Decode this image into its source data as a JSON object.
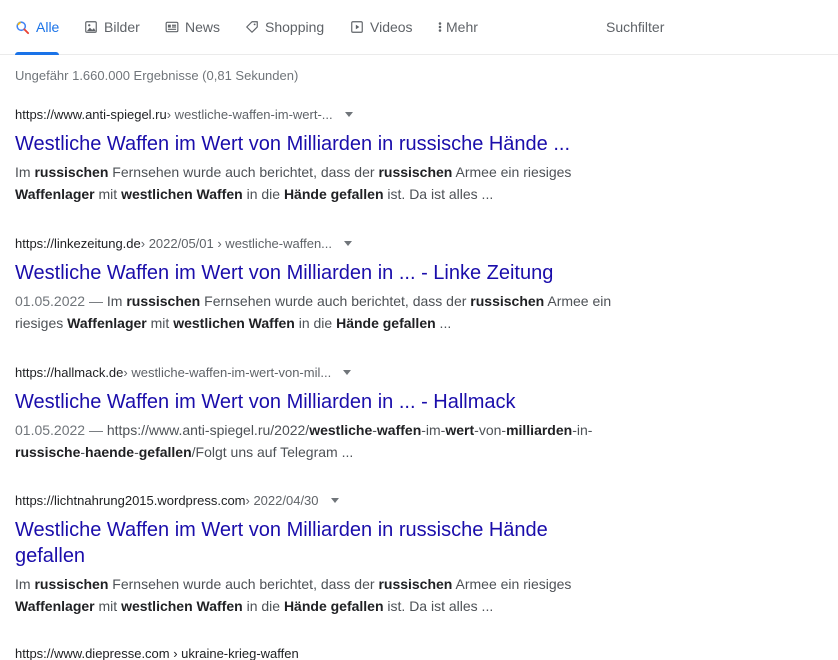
{
  "tabs": [
    {
      "label": "Alle",
      "icon": "search-icon"
    },
    {
      "label": "Bilder",
      "icon": "image-icon"
    },
    {
      "label": "News",
      "icon": "news-icon"
    },
    {
      "label": "Shopping",
      "icon": "tag-icon"
    },
    {
      "label": "Videos",
      "icon": "play-icon"
    },
    {
      "label": "Mehr",
      "icon": "more-vertical-icon"
    }
  ],
  "filter_label": "Suchfilter",
  "stats": "Ungefähr 1.660.000 Ergebnisse (0,81 Sekunden)",
  "results": [
    {
      "domain": "https://www.anti-spiegel.ru",
      "path": " › westliche-waffen-im-wert-...",
      "title": "Westliche Waffen im Wert von Milliarden in russische Hände ...",
      "snippet_html": "Im <b>russischen</b> Fernsehen wurde auch berichtet, dass der <b>russischen</b> Armee ein riesiges <b>Waffenlager</b> mit <b>westlichen Waffen</b> in die <b>Hände gefallen</b> ist. Da ist alles ..."
    },
    {
      "domain": "https://linkezeitung.de",
      "path": " › 2022/05/01 › westliche-waffen...",
      "title": "Westliche Waffen im Wert von Milliarden in ... - Linke Zeitung",
      "snippet_html": "<span class=\"date\">01.05.2022 — </span>Im <b>russischen</b> Fernsehen wurde auch berichtet, dass der <b>russischen</b> Armee ein riesiges <b>Waffenlager</b> mit <b>westlichen Waffen</b> in die <b>Hände gefallen</b> ..."
    },
    {
      "domain": "https://hallmack.de",
      "path": " › westliche-waffen-im-wert-von-mil...",
      "title": "Westliche Waffen im Wert von Milliarden in ... - Hallmack",
      "snippet_html": "<span class=\"date\">01.05.2022 — </span>https://www.anti-spiegel.ru/2022/<b>westliche</b>-<b>waffen</b>-im-<b>wert</b>-von-<b>milliarden</b>-in-<b>russische</b>-<b>haende</b>-<b>gefallen</b>/Folgt uns auf Telegram ..."
    },
    {
      "domain": "https://lichtnahrung2015.wordpress.com",
      "path": " › 2022/04/30",
      "title": "Westliche Waffen im Wert von Milliarden in russische Hände gefallen",
      "snippet_html": "Im <b>russischen</b> Fernsehen wurde auch berichtet, dass der <b>russischen</b> Armee ein riesiges <b>Waffenlager</b> mit <b>westlichen Waffen</b> in die <b>Hände gefallen</b> ist. Da ist alles ..."
    }
  ],
  "next_cite": "https://www.diepresse.com › ukraine-krieg-waffen"
}
